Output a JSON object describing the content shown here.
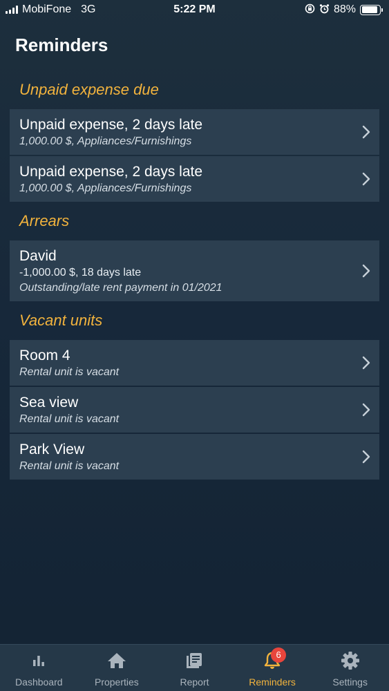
{
  "status_bar": {
    "carrier": "MobiFone",
    "network": "3G",
    "time": "5:22 PM",
    "battery": "88%"
  },
  "page": {
    "title": "Reminders"
  },
  "sections": [
    {
      "title": "Unpaid expense due",
      "items": [
        {
          "title": "Unpaid expense, 2 days late",
          "detail": "1,000.00 $, Appliances/Furnishings"
        },
        {
          "title": "Unpaid expense, 2 days late",
          "detail": "1,000.00 $, Appliances/Furnishings"
        }
      ]
    },
    {
      "title": "Arrears",
      "items": [
        {
          "title": "David",
          "line2": "-1,000.00 $, 18 days late",
          "detail": "Outstanding/late rent payment in 01/2021"
        }
      ]
    },
    {
      "title": "Vacant units",
      "items": [
        {
          "title": "Room 4",
          "detail": "Rental unit is vacant"
        },
        {
          "title": "Sea view",
          "detail": "Rental unit is vacant"
        },
        {
          "title": "Park View",
          "detail": "Rental unit is vacant"
        }
      ]
    }
  ],
  "tab_bar": {
    "tabs": [
      {
        "label": "Dashboard",
        "icon": "bar-chart-icon"
      },
      {
        "label": "Properties",
        "icon": "home-icon"
      },
      {
        "label": "Report",
        "icon": "report-icon"
      },
      {
        "label": "Reminders",
        "icon": "bell-icon",
        "badge": "6",
        "active": true
      },
      {
        "label": "Settings",
        "icon": "gear-icon"
      }
    ]
  },
  "colors": {
    "background": "#17283a",
    "card": "#2c3f50",
    "section_title": "#f2b33d",
    "active_tab": "#f2b33d",
    "badge": "#e8453c"
  }
}
